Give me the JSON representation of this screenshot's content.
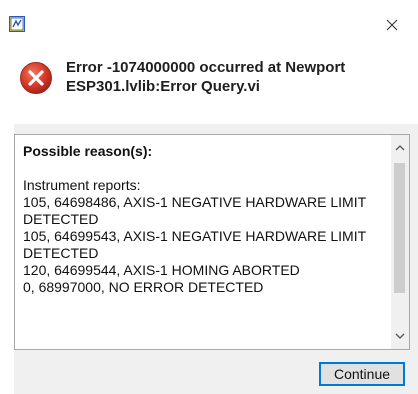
{
  "titlebar": {
    "app_icon": "labview-app-icon",
    "close_icon": "close-icon"
  },
  "error": {
    "icon": "error-x-circle-icon",
    "title": "Error -1074000000 occurred at Newport\nESP301.lvlib:Error Query.vi"
  },
  "reasons": {
    "heading": "Possible reason(s):",
    "lines": [
      "Instrument reports:",
      "105, 64698486, AXIS-1 NEGATIVE HARDWARE LIMIT DETECTED",
      "105, 64699543, AXIS-1 NEGATIVE HARDWARE LIMIT DETECTED",
      "120, 64699544, AXIS-1 HOMING ABORTED",
      "0, 68997000, NO ERROR DETECTED"
    ]
  },
  "buttons": {
    "continue_label": "Continue"
  },
  "colors": {
    "error_red": "#d83b2b",
    "accent_blue": "#0078d7",
    "panel_gray": "#f0f0f0"
  }
}
